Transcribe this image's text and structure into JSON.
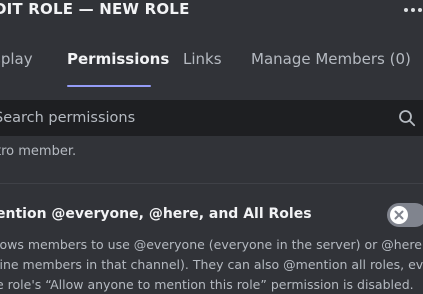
{
  "header": {
    "title": "DIT ROLE — NEW ROLE"
  },
  "tabs": [
    {
      "label": "splay",
      "active": false
    },
    {
      "label": "Permissions",
      "active": true
    },
    {
      "label": "Links",
      "active": false
    },
    {
      "label": "Manage Members (0)",
      "active": false
    }
  ],
  "search": {
    "placeholder": "Search permissions",
    "value": ""
  },
  "previous_permission": {
    "description_tail": "tro member."
  },
  "permission": {
    "title": "ention @everyone, @here, and All Roles",
    "enabled": false,
    "description_lines": [
      "lows members to use @everyone (everyone in the server) or @here (only",
      "line members in that channel). They can also @mention all roles, even if",
      "e role's “Allow anyone to mention this role” permission is disabled."
    ]
  },
  "colors": {
    "background": "#313338",
    "search_bg": "#1e1f22",
    "accent": "#949cf7",
    "toggle_off": "#80848e"
  },
  "icons": {
    "more": "more-horizontal-icon",
    "search": "search-icon",
    "toggle_off": "x-icon"
  }
}
